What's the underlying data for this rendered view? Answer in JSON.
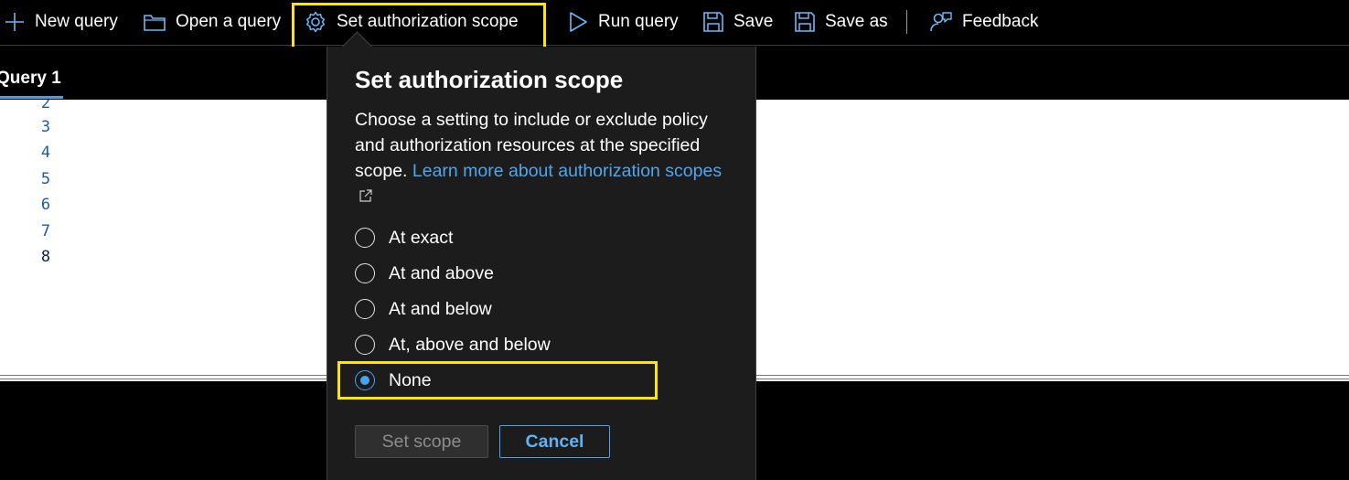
{
  "toolbar": {
    "new_query": "New query",
    "open_query": "Open a query",
    "set_scope": "Set authorization scope",
    "run_query": "Run query",
    "save": "Save",
    "save_as": "Save as",
    "feedback": "Feedback"
  },
  "tabs": [
    {
      "label": "Query 1",
      "active": true
    }
  ],
  "editor": {
    "line_numbers": [
      "2",
      "3",
      "4",
      "5",
      "6",
      "7",
      "8"
    ],
    "active_line": "8"
  },
  "flyout": {
    "title": "Set authorization scope",
    "description": "Choose a setting to include or exclude policy and authorization resources at the specified scope.",
    "link_text": "Learn more about authorization scopes",
    "options": [
      {
        "label": "At exact",
        "selected": false
      },
      {
        "label": "At and above",
        "selected": false
      },
      {
        "label": "At and below",
        "selected": false
      },
      {
        "label": "At, above and below",
        "selected": false
      },
      {
        "label": "None",
        "selected": true
      }
    ],
    "primary_button": "Set scope",
    "secondary_button": "Cancel"
  },
  "colors": {
    "highlight": "#ffe600",
    "accent": "#4aa3f0",
    "flyout_bg": "#1c1c1c"
  }
}
